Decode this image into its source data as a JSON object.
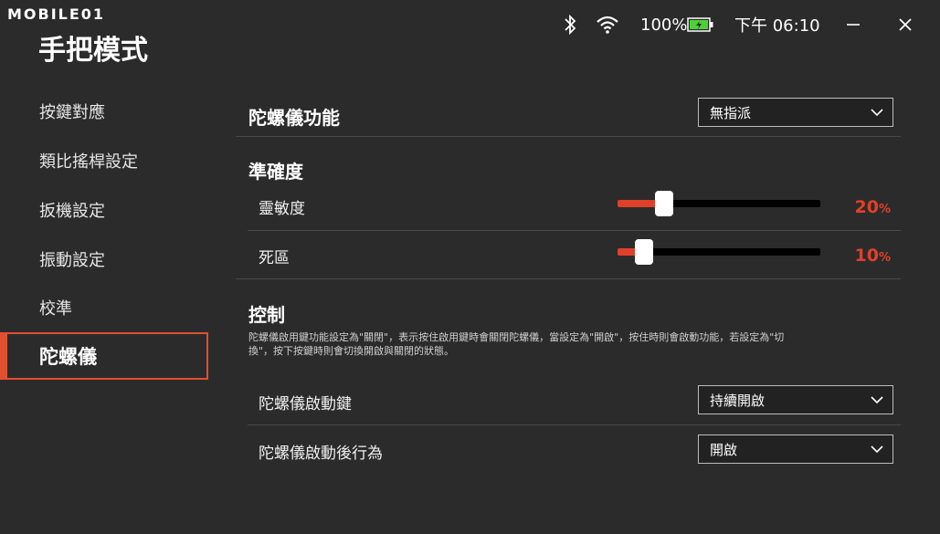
{
  "watermark": "MOBILE01",
  "status": {
    "battery": "100%",
    "time": "下午 06:10",
    "battery_color": "#4cd137"
  },
  "page_title": "手把模式",
  "sidebar": {
    "items": [
      {
        "label": "按鍵對應"
      },
      {
        "label": "類比搖桿設定"
      },
      {
        "label": "扳機設定"
      },
      {
        "label": "振動設定"
      },
      {
        "label": "校準"
      },
      {
        "label": "陀螺儀"
      }
    ],
    "active_index": 5
  },
  "gyro": {
    "title": "陀螺儀功能",
    "value": "無指派"
  },
  "precision": {
    "title": "準確度",
    "sensitivity": {
      "label": "靈敏度",
      "value": "20",
      "unit": "%",
      "fraction": 0.2
    },
    "deadzone": {
      "label": "死區",
      "value": "10",
      "unit": "%",
      "fraction": 0.1
    }
  },
  "control": {
    "title": "控制",
    "description_line1": "陀螺儀啟用鍵功能設定為\"關閉\"，表示按住啟用鍵時會關閉陀螺儀，當設定為\"開啟\"，按住時則會啟動功能，若設定為\"切",
    "description_line2": "換\"，按下按鍵時則會切換開啟與關閉的狀態。",
    "activate_key": {
      "label": "陀螺儀啟動鍵",
      "value": "持續開啟"
    },
    "after_activate": {
      "label": "陀螺儀啟動後行為",
      "value": "開啟"
    }
  },
  "accent_color": "#e0502f"
}
